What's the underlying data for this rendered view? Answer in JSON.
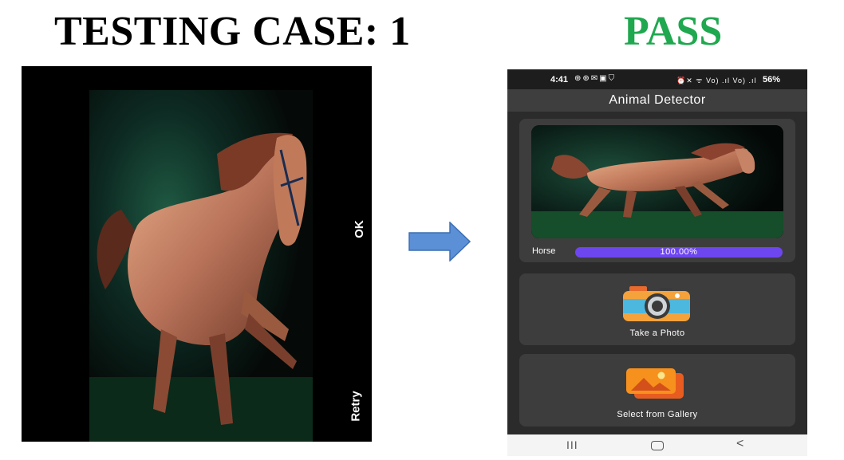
{
  "header": {
    "case_title": "TESTING CASE: 1",
    "result": "PASS",
    "result_color": "#1fa84f"
  },
  "camera": {
    "ok_label": "OK",
    "retry_label": "Retry",
    "back_glyph": "<",
    "recents_glyph": "III"
  },
  "phone": {
    "status": {
      "time": "4:41",
      "icons_left": "⊕⊕✉▣⛉",
      "icons_right": "⏰✕ ᯤ Vo) .ıl Vo) .ıl",
      "battery": "56%"
    },
    "app_title": "Animal Detector",
    "result": {
      "label": "Horse",
      "confidence_text": "100.00%",
      "confidence": 1.0,
      "bar_color": "#6e46f0"
    },
    "take_photo_label": "Take a Photo",
    "gallery_label": "Select from Gallery",
    "nav": {
      "recents": "III",
      "back": "<"
    }
  }
}
